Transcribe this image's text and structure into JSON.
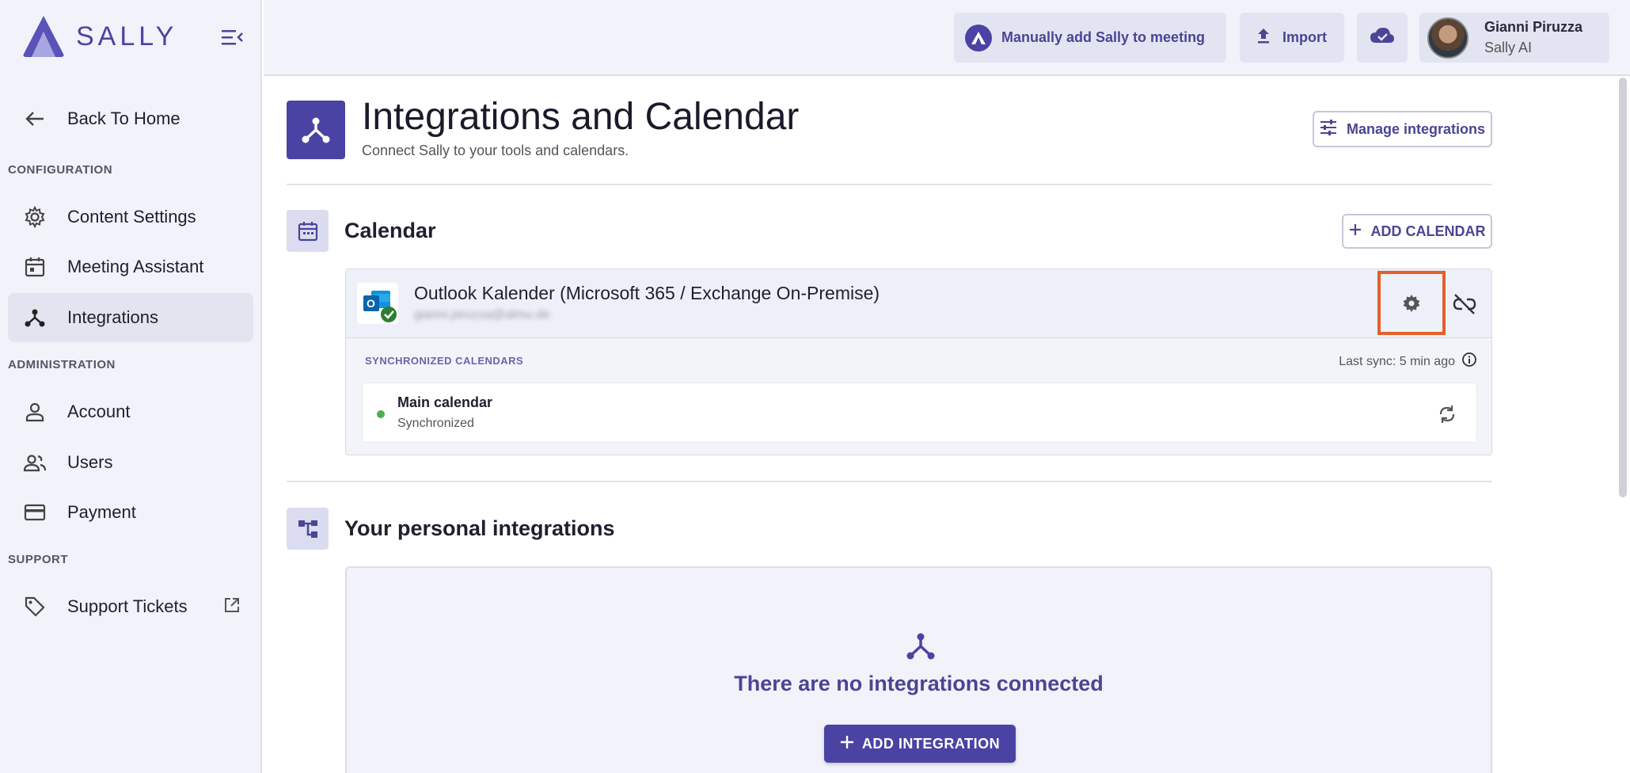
{
  "app": {
    "logo_text": "SALLY",
    "accent": "#4b43a3",
    "highlight": "#e0622a"
  },
  "sidebar": {
    "back": "Back To Home",
    "sections": {
      "configuration": "CONFIGURATION",
      "administration": "ADMINISTRATION",
      "support": "SUPPORT"
    },
    "items": {
      "content_settings": "Content Settings",
      "meeting_assistant": "Meeting Assistant",
      "integrations": "Integrations",
      "account": "Account",
      "users": "Users",
      "payment": "Payment",
      "support_tickets": "Support Tickets"
    }
  },
  "topbar": {
    "manual_add": "Manually add Sally to meeting",
    "import": "Import",
    "user_name": "Gianni Piruzza",
    "user_org": "Sally AI"
  },
  "page": {
    "title": "Integrations and Calendar",
    "subtitle": "Connect Sally to your tools and calendars.",
    "manage_button": "Manage integrations"
  },
  "calendar": {
    "section_title": "Calendar",
    "add_button": "ADD CALENDAR",
    "provider": "Outlook Kalender (Microsoft 365 / Exchange On-Premise)",
    "email": "gianni.piruzza@almu.de",
    "synced_label": "SYNCHRONIZED CALENDARS",
    "last_sync": "Last sync: 5 min ago",
    "rows": [
      {
        "title": "Main calendar",
        "status": "Synchronized",
        "status_color": "#4caf50"
      }
    ]
  },
  "personal": {
    "section_title": "Your personal integrations",
    "empty_text": "There are no integrations connected",
    "add_button": "ADD INTEGRATION"
  }
}
